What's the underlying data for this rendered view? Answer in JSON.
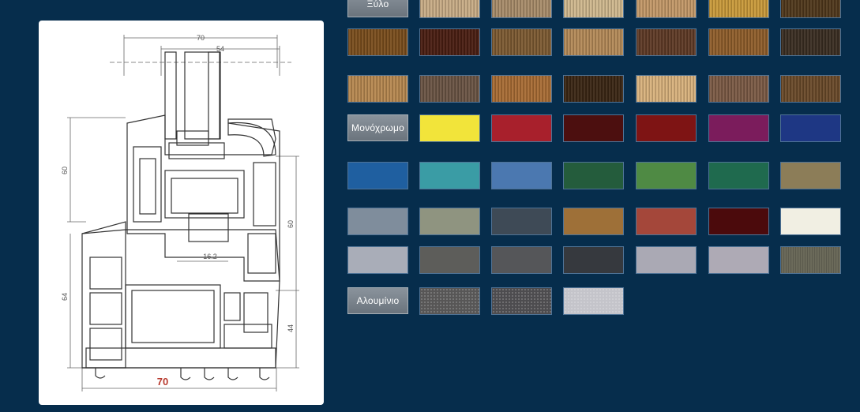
{
  "categories": {
    "wood_label": "Ξύλο",
    "mono_label": "Μονόχρωμο",
    "alu_label": "Αλουμίνιο"
  },
  "drawing": {
    "dim_top_outer": "70",
    "dim_top_inner": "54",
    "dim_left_upper": "60",
    "dim_left_lower": "64",
    "dim_right_upper": "60",
    "dim_right_lower": "44",
    "dim_center": "16.2",
    "dim_bottom": "70"
  },
  "swatch_rows": [
    {
      "label_key": "wood",
      "colors": [
        "#c8ac86",
        "#a88c6a",
        "#cfb88e",
        "#c39868",
        "#c99a3a",
        "#50381c"
      ]
    },
    {
      "label_key": null,
      "colors": [
        "#7a4e1d",
        "#4a1e12",
        "#7d5a32",
        "#b48a58",
        "#5f3a26",
        "#8f5e2b",
        "#3a2e22"
      ]
    },
    {
      "label_key": null,
      "colors": [
        "#b78850",
        "#6a5444",
        "#a86c34",
        "#3a2614",
        "#d8b17c",
        "#7b5a45",
        "#6a4a2a"
      ]
    },
    {
      "label_key": "mono",
      "colors": [
        "#f2e43a",
        "#a8202c",
        "#4c0f0f",
        "#7e1414",
        "#7b1c5c",
        "#1e3784"
      ]
    },
    {
      "label_key": null,
      "colors": [
        "#1f5fa0",
        "#3a9ca5",
        "#4b78b0",
        "#245c3c",
        "#4f8a44",
        "#1f6a4e",
        "#8c7d58"
      ]
    },
    {
      "label_key": null,
      "colors": [
        "#7f8d9c",
        "#8f9480",
        "#3e4a56",
        "#9e7038",
        "#a4473a",
        "#4b0a0c",
        "#f1efe3"
      ]
    },
    {
      "label_key": null,
      "colors": [
        "#a9adb8",
        "#5d5d5a",
        "#555659",
        "#36393e",
        "#aaa9b4",
        "#aeaab5",
        "#6b6a5a"
      ]
    },
    {
      "label_key": "alu",
      "colors": [
        "#575656",
        "#4d4c4f",
        "#c4c4ca"
      ]
    }
  ],
  "texture_note": "wood"
}
